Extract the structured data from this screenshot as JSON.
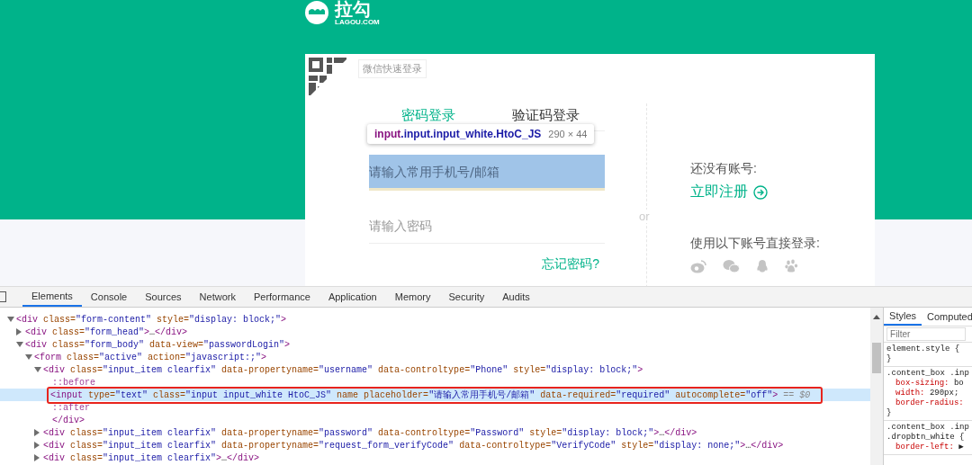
{
  "page": {
    "logo": {
      "name": "拉勾",
      "domain": "LAGOU.COM"
    },
    "wechat_login": {
      "label": "微信快速登录"
    },
    "login_tabs": [
      {
        "label": "密码登录",
        "selected": true
      },
      {
        "label": "验证码登录",
        "selected": false
      }
    ],
    "fields": [
      {
        "placeholder": "请输入常用手机号/邮箱",
        "inspected": true
      },
      {
        "placeholder": "请输入密码",
        "inspected": false
      }
    ],
    "forgot_link": "忘记密码?",
    "divider_label": "or",
    "register": {
      "prompt": "还没有账号:",
      "link": "立即注册"
    },
    "social": {
      "prompt": "使用以下账号直接登录:"
    }
  },
  "inspect_tooltip": {
    "tag": "input",
    "classes": ".input.input_white.HtoC_JS",
    "size": "290 × 44"
  },
  "devtools": {
    "tabs": [
      {
        "label": "Elements",
        "selected": true
      },
      {
        "label": "Console",
        "selected": false
      },
      {
        "label": "Sources",
        "selected": false
      },
      {
        "label": "Network",
        "selected": false
      },
      {
        "label": "Performance",
        "selected": false
      },
      {
        "label": "Application",
        "selected": false
      },
      {
        "label": "Memory",
        "selected": false
      },
      {
        "label": "Security",
        "selected": false
      },
      {
        "label": "Audits",
        "selected": false
      }
    ],
    "dom_tree": [
      {
        "kind": "element",
        "expanded": true,
        "selected": false,
        "tokens": [
          {
            "kind": "tag",
            "text": "<div"
          },
          {
            "kind": "attr",
            "text": " class="
          },
          {
            "kind": "value",
            "text": "\"form-content\""
          },
          {
            "kind": "attr",
            "text": " style="
          },
          {
            "kind": "value",
            "text": "\"display: block;\""
          },
          {
            "kind": "tag",
            "text": ">"
          }
        ],
        "children": [
          {
            "kind": "element",
            "expanded": false,
            "selected": false,
            "tokens": [
              {
                "kind": "tag",
                "text": "<div"
              },
              {
                "kind": "attr",
                "text": " class="
              },
              {
                "kind": "value",
                "text": "\"form_head\""
              },
              {
                "kind": "tag",
                "text": ">"
              },
              {
                "kind": "ellipsis",
                "text": "…"
              },
              {
                "kind": "tag",
                "text": "</div>"
              }
            ]
          },
          {
            "kind": "element",
            "expanded": true,
            "selected": false,
            "tokens": [
              {
                "kind": "tag",
                "text": "<div"
              },
              {
                "kind": "attr",
                "text": " class="
              },
              {
                "kind": "value",
                "text": "\"form_body\""
              },
              {
                "kind": "attr",
                "text": " data-view="
              },
              {
                "kind": "value",
                "text": "\"passwordLogin\""
              },
              {
                "kind": "tag",
                "text": ">"
              }
            ],
            "children": [
              {
                "kind": "element",
                "expanded": true,
                "selected": false,
                "tokens": [
                  {
                    "kind": "tag",
                    "text": "<form"
                  },
                  {
                    "kind": "attr",
                    "text": " class="
                  },
                  {
                    "kind": "value",
                    "text": "\"active\""
                  },
                  {
                    "kind": "attr",
                    "text": " action="
                  },
                  {
                    "kind": "value",
                    "text": "\"javascript:;\""
                  },
                  {
                    "kind": "tag",
                    "text": ">"
                  }
                ],
                "children": [
                  {
                    "kind": "element",
                    "expanded": true,
                    "selected": false,
                    "tokens": [
                      {
                        "kind": "tag",
                        "text": "<div"
                      },
                      {
                        "kind": "attr",
                        "text": " class="
                      },
                      {
                        "kind": "value",
                        "text": "\"input_item clearfix\""
                      },
                      {
                        "kind": "attr",
                        "text": " data-propertyname="
                      },
                      {
                        "kind": "value",
                        "text": "\"username\""
                      },
                      {
                        "kind": "attr",
                        "text": " data-controltype="
                      },
                      {
                        "kind": "value",
                        "text": "\"Phone\""
                      },
                      {
                        "kind": "attr",
                        "text": " style="
                      },
                      {
                        "kind": "value",
                        "text": "\"display: block;\""
                      },
                      {
                        "kind": "tag",
                        "text": ">"
                      }
                    ],
                    "children": [
                      {
                        "kind": "pseudo",
                        "selected": false,
                        "tokens": [
                          {
                            "kind": "pseudo",
                            "text": "::before"
                          }
                        ]
                      },
                      {
                        "kind": "leaf",
                        "selected": true,
                        "tokens": [
                          {
                            "kind": "tag",
                            "text": "<input"
                          },
                          {
                            "kind": "attr",
                            "text": " type="
                          },
                          {
                            "kind": "value",
                            "text": "\"text\""
                          },
                          {
                            "kind": "attr",
                            "text": " class="
                          },
                          {
                            "kind": "value",
                            "text": "\"input input_white HtoC_JS\""
                          },
                          {
                            "kind": "attr",
                            "text": " name placeholder="
                          },
                          {
                            "kind": "value",
                            "text": "\"请输入常用手机号/邮箱\""
                          },
                          {
                            "kind": "attr",
                            "text": " data-required="
                          },
                          {
                            "kind": "value",
                            "text": "\"required\""
                          },
                          {
                            "kind": "attr",
                            "text": " autocomplete="
                          },
                          {
                            "kind": "value",
                            "text": "\"off\""
                          },
                          {
                            "kind": "tag",
                            "text": ">"
                          },
                          {
                            "kind": "ref",
                            "text": " == $0"
                          }
                        ]
                      },
                      {
                        "kind": "pseudo",
                        "selected": false,
                        "tokens": [
                          {
                            "kind": "pseudo",
                            "text": "::after"
                          }
                        ]
                      },
                      {
                        "kind": "closing",
                        "selected": false,
                        "tokens": [
                          {
                            "kind": "tag",
                            "text": "</div>"
                          }
                        ]
                      }
                    ]
                  },
                  {
                    "kind": "element",
                    "expanded": false,
                    "selected": false,
                    "tokens": [
                      {
                        "kind": "tag",
                        "text": "<div"
                      },
                      {
                        "kind": "attr",
                        "text": " class="
                      },
                      {
                        "kind": "value",
                        "text": "\"input_item clearfix\""
                      },
                      {
                        "kind": "attr",
                        "text": " data-propertyname="
                      },
                      {
                        "kind": "value",
                        "text": "\"password\""
                      },
                      {
                        "kind": "attr",
                        "text": " data-controltype="
                      },
                      {
                        "kind": "value",
                        "text": "\"Password\""
                      },
                      {
                        "kind": "attr",
                        "text": " style="
                      },
                      {
                        "kind": "value",
                        "text": "\"display: block;\""
                      },
                      {
                        "kind": "tag",
                        "text": ">"
                      },
                      {
                        "kind": "ellipsis",
                        "text": "…"
                      },
                      {
                        "kind": "tag",
                        "text": "</div>"
                      }
                    ]
                  },
                  {
                    "kind": "element",
                    "expanded": false,
                    "selected": false,
                    "tokens": [
                      {
                        "kind": "tag",
                        "text": "<div"
                      },
                      {
                        "kind": "attr",
                        "text": " class="
                      },
                      {
                        "kind": "value",
                        "text": "\"input_item clearfix\""
                      },
                      {
                        "kind": "attr",
                        "text": " data-propertyname="
                      },
                      {
                        "kind": "value",
                        "text": "\"request_form_verifyCode\""
                      },
                      {
                        "kind": "attr",
                        "text": " data-controltype="
                      },
                      {
                        "kind": "value",
                        "text": "\"VerifyCode\""
                      },
                      {
                        "kind": "attr",
                        "text": " style="
                      },
                      {
                        "kind": "value",
                        "text": "\"display: none;\""
                      },
                      {
                        "kind": "tag",
                        "text": ">"
                      },
                      {
                        "kind": "ellipsis",
                        "text": "…"
                      },
                      {
                        "kind": "tag",
                        "text": "</div>"
                      }
                    ]
                  },
                  {
                    "kind": "element",
                    "expanded": false,
                    "selected": false,
                    "tokens": [
                      {
                        "kind": "tag",
                        "text": "<div"
                      },
                      {
                        "kind": "attr",
                        "text": " class="
                      },
                      {
                        "kind": "value",
                        "text": "\"input_item clearfix\""
                      },
                      {
                        "kind": "tag",
                        "text": ">"
                      },
                      {
                        "kind": "ellipsis",
                        "text": "…"
                      },
                      {
                        "kind": "tag",
                        "text": "</div>"
                      }
                    ]
                  }
                ]
              }
            ]
          }
        ]
      }
    ],
    "styles_panel": {
      "tabs": [
        {
          "label": "Styles",
          "selected": true
        },
        {
          "label": "Computed",
          "selected": false
        }
      ],
      "filter": {
        "placeholder": "Filter"
      },
      "rules": [
        {
          "selectors": [
            "element.style {"
          ],
          "close": "}"
        },
        {
          "selectors": [
            ".content_box .inp"
          ],
          "declarations": [
            {
              "property": "box-sizing:",
              "value": "bo"
            },
            {
              "property": "width:",
              "value": "290px;"
            },
            {
              "property": "border-radius:"
            }
          ],
          "close": "}"
        },
        {
          "selectors": [
            ".content_box .inp",
            ".dropbtn_white {"
          ],
          "declarations": [
            {
              "property": "border-left:",
              "value": "▶"
            }
          ]
        }
      ]
    }
  }
}
